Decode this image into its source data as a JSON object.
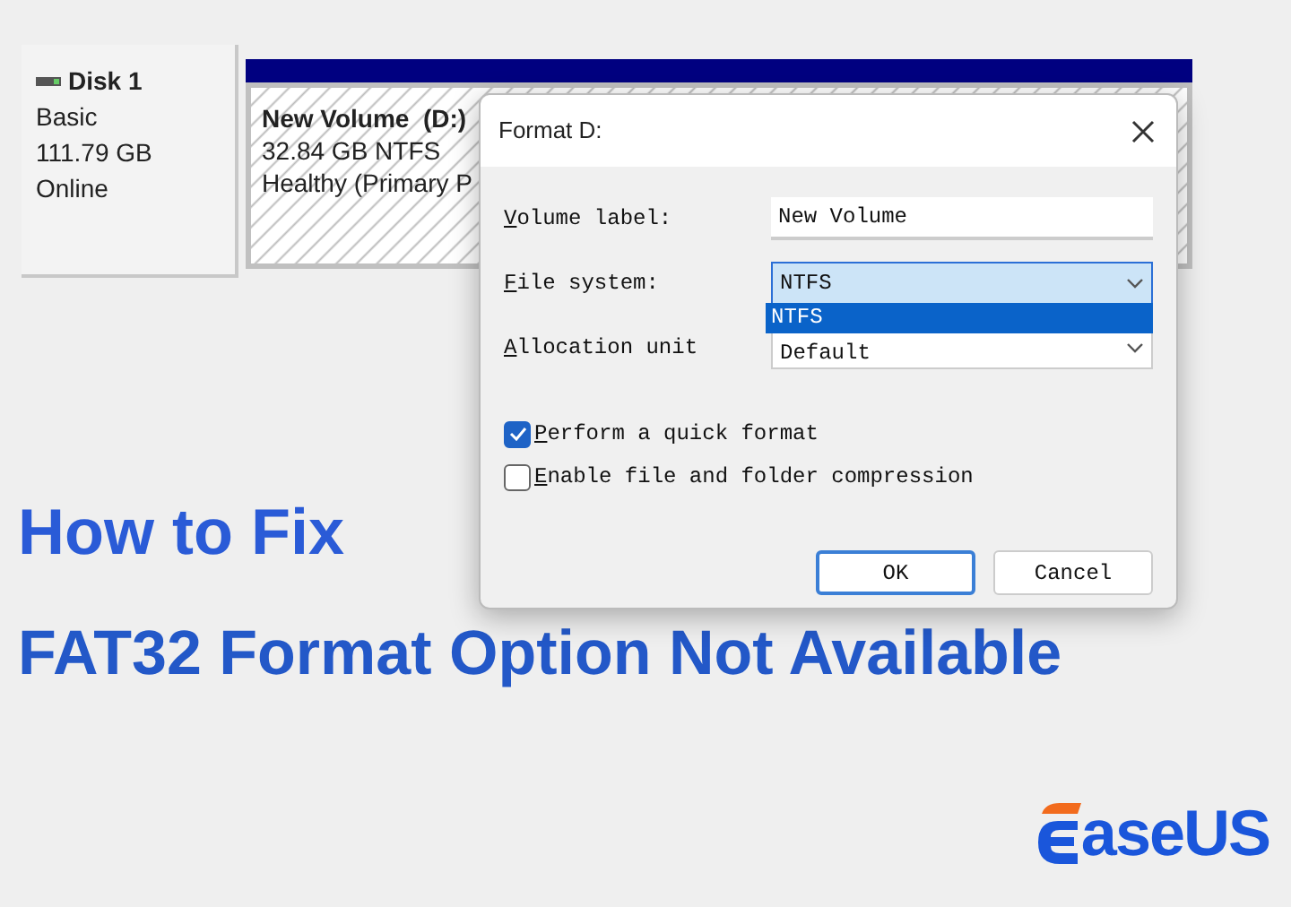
{
  "disk": {
    "name": "Disk 1",
    "type": "Basic",
    "size": "111.79 GB",
    "status": "Online"
  },
  "volume": {
    "name": "New Volume  (D:)",
    "size": "32.84 GB NTFS",
    "status": "Healthy (Primary P"
  },
  "dialog": {
    "title": "Format D:",
    "fields": [
      {
        "kind": "text",
        "label": "Volume label:",
        "value": "New Volume"
      },
      {
        "kind": "select",
        "label": "File system:",
        "value": "NTFS",
        "expanded": true,
        "options": [
          {
            "label": "NTFS",
            "selected": true
          }
        ]
      },
      {
        "kind": "select",
        "label": "Allocation unit",
        "value": "Default",
        "expanded": false
      }
    ],
    "checkboxes": [
      {
        "label": "Perform a quick format",
        "checked": true
      },
      {
        "label": "Enable file and folder compression",
        "checked": false
      }
    ],
    "buttons": [
      {
        "label": "OK",
        "default": true
      },
      {
        "label": "Cancel",
        "default": false
      }
    ]
  },
  "headline": [
    "How to Fix",
    "FAT32 Format Option Not Available"
  ],
  "logo": {
    "text": "aseUS"
  }
}
